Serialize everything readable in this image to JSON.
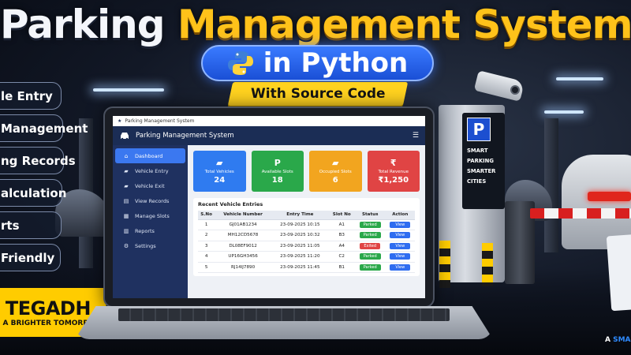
{
  "headline": {
    "part1": "Parking",
    "part2": "Management System",
    "python_label": "in Python",
    "ribbon": "With Source Code"
  },
  "features": [
    "le Entry",
    "Management",
    "ng Records",
    "alculation",
    "rts",
    "Friendly"
  ],
  "brand": {
    "name": "TEGADH",
    "tagline": "A BRIGHTER TOMORROW"
  },
  "app": {
    "window_title": "Parking Management System",
    "header_title": "Parking Management System",
    "menu_icon": "☰",
    "nav": [
      {
        "label": "Dashboard",
        "icon": "dashboard-icon",
        "glyph": "⌂",
        "active": true
      },
      {
        "label": "Vehicle Entry",
        "icon": "car-icon",
        "glyph": "▰",
        "active": false
      },
      {
        "label": "Vehicle Exit",
        "icon": "car-exit-icon",
        "glyph": "▰",
        "active": false
      },
      {
        "label": "View Records",
        "icon": "records-icon",
        "glyph": "▤",
        "active": false
      },
      {
        "label": "Manage Slots",
        "icon": "slots-icon",
        "glyph": "▦",
        "active": false
      },
      {
        "label": "Reports",
        "icon": "reports-icon",
        "glyph": "▥",
        "active": false
      },
      {
        "label": "Settings",
        "icon": "gear-icon",
        "glyph": "⚙",
        "active": false
      }
    ],
    "cards": [
      {
        "label": "Total Vehicles",
        "value": "24",
        "glyph": "▰",
        "icon": "car-icon",
        "color": "#2f7bf0"
      },
      {
        "label": "Available Slots",
        "value": "18",
        "glyph": "P",
        "icon": "parking-icon",
        "color": "#2aa84a"
      },
      {
        "label": "Occupied Slots",
        "value": "6",
        "glyph": "▰",
        "icon": "car-icon",
        "color": "#f2a51f"
      },
      {
        "label": "Total Revenue",
        "value": "₹1,250",
        "glyph": "₹",
        "icon": "rupee-icon",
        "color": "#e04444"
      }
    ],
    "table": {
      "title": "Recent Vehicle Entries",
      "columns": [
        "S.No",
        "Vehicle Number",
        "Entry Time",
        "Slot No",
        "Status",
        "Action"
      ],
      "rows": [
        {
          "sno": "1",
          "vehicle": "GJ01AB1234",
          "time": "23-09-2025 10:15",
          "slot": "A1",
          "status": "Parked",
          "status_color": "#2aa84a",
          "action": "View"
        },
        {
          "sno": "2",
          "vehicle": "MH12CD5678",
          "time": "23-09-2025 10:32",
          "slot": "B3",
          "status": "Parked",
          "status_color": "#2aa84a",
          "action": "View"
        },
        {
          "sno": "3",
          "vehicle": "DL08EF9012",
          "time": "23-09-2025 11:05",
          "slot": "A4",
          "status": "Exited",
          "status_color": "#e04444",
          "action": "View"
        },
        {
          "sno": "4",
          "vehicle": "UP16GH3456",
          "time": "23-09-2025 11:20",
          "slot": "C2",
          "status": "Parked",
          "status_color": "#2aa84a",
          "action": "View"
        },
        {
          "sno": "5",
          "vehicle": "RJ14IJ7890",
          "time": "23-09-2025 11:45",
          "slot": "B1",
          "status": "Parked",
          "status_color": "#2aa84a",
          "action": "View"
        }
      ]
    }
  },
  "kiosk": {
    "sign": "P",
    "lines": [
      "SMART",
      "PARKING",
      "SMARTER",
      "CITIES"
    ]
  },
  "watermark": {
    "prefix": "A ",
    "highlight": "SMA"
  }
}
